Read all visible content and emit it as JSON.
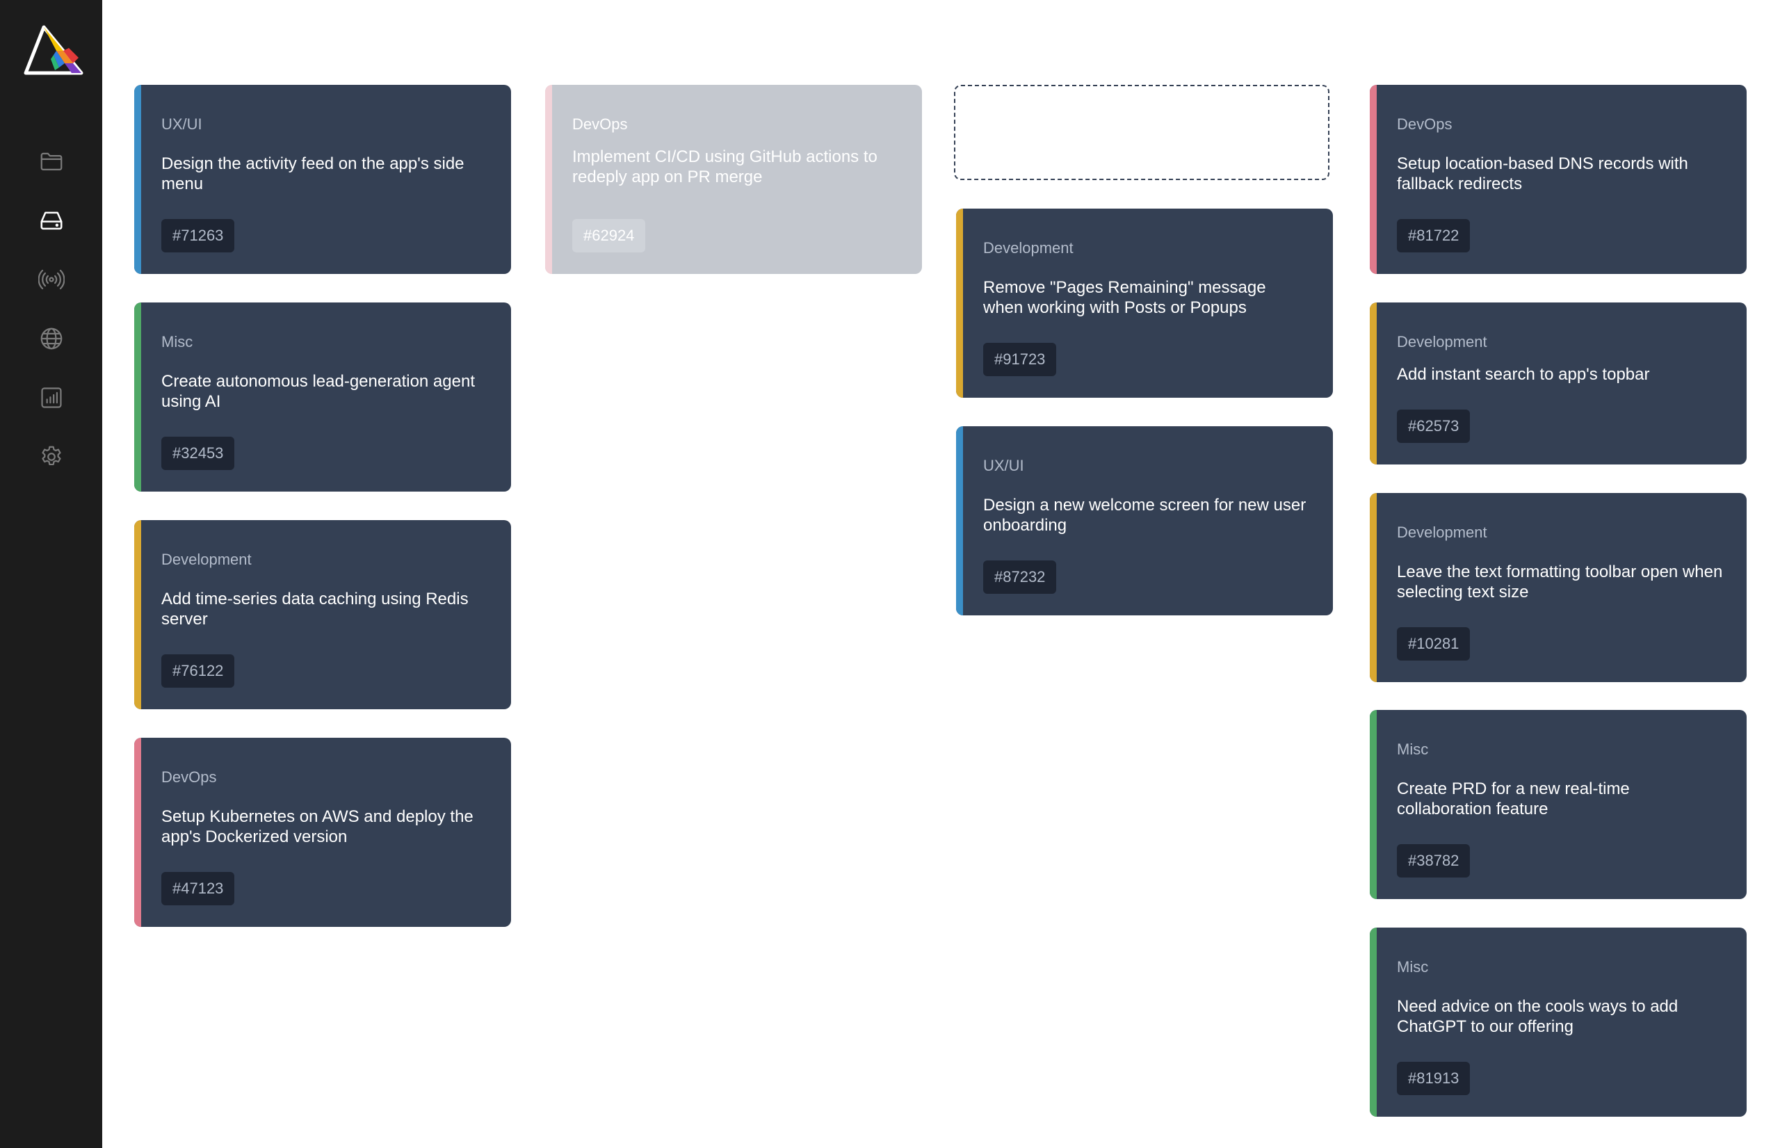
{
  "nav": {
    "items": [
      {
        "name": "folder-icon",
        "active": false
      },
      {
        "name": "inbox-drive-icon",
        "active": true
      },
      {
        "name": "broadcast-icon",
        "active": false
      },
      {
        "name": "globe-icon",
        "active": false
      },
      {
        "name": "bar-chart-icon",
        "active": false
      },
      {
        "name": "settings-gear-icon",
        "active": false
      }
    ]
  },
  "colors": {
    "ux_ui": "#3b8fc7",
    "devops": "#e07a8c",
    "development": "#d9a830",
    "misc": "#4fa866",
    "card_bg": "#344054",
    "sidebar_bg": "#1c1c1c"
  },
  "columns": [
    {
      "cards": [
        {
          "category": "UX/UI",
          "title": "Design the activity feed on the app's side menu",
          "id": "#71263"
        },
        {
          "category": "Misc",
          "title": "Create autonomous lead-generation agent using AI",
          "id": "#32453"
        },
        {
          "category": "Development",
          "title": "Add time-series data caching using Redis server",
          "id": "#76122"
        },
        {
          "category": "DevOps",
          "title": "Setup Kubernetes on AWS and deploy the app's Dockerized version",
          "id": "#47123"
        }
      ]
    },
    {
      "cards": [
        {
          "category": "DevOps",
          "title": "Implement CI/CD using GitHub actions to redeply app on PR merge",
          "id": "#62924",
          "state": "dragging"
        }
      ]
    },
    {
      "cards": [
        {
          "category": "Development",
          "title": "Remove \"Pages Remaining\" message when working with Posts or Popups",
          "id": "#91723"
        },
        {
          "category": "UX/UI",
          "title": "Design a new welcome screen for new user onboarding",
          "id": "#87232"
        }
      ]
    },
    {
      "cards": [
        {
          "category": "DevOps",
          "title": "Setup location-based DNS records with fallback redirects",
          "id": "#81722"
        },
        {
          "category": "Development",
          "title": "Add instant search to app's topbar",
          "id": "#62573"
        },
        {
          "category": "Development",
          "title": "Leave the text formatting toolbar open when selecting text size",
          "id": "#10281"
        },
        {
          "category": "Misc",
          "title": "Create PRD for a new real-time collaboration feature",
          "id": "#38782"
        },
        {
          "category": "Misc",
          "title": "Need advice on the cools ways to add ChatGPT to our offering",
          "id": "#81913"
        }
      ]
    }
  ]
}
